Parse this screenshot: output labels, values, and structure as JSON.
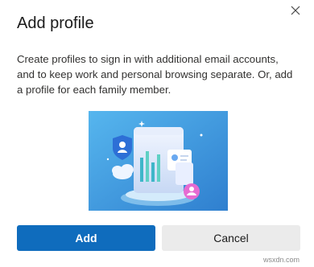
{
  "dialog": {
    "title": "Add profile",
    "description": "Create profiles to sign in with additional email accounts, and to keep work and personal browsing separate. Or, add a profile for each family member.",
    "close_icon": "close-icon",
    "illustration": "profile-illustration"
  },
  "buttons": {
    "add_label": "Add",
    "cancel_label": "Cancel"
  },
  "watermark": "wsxdn.com",
  "colors": {
    "primary": "#0f6cbd",
    "secondary": "#ebebeb",
    "illustration_bg": "#3b94d9"
  }
}
